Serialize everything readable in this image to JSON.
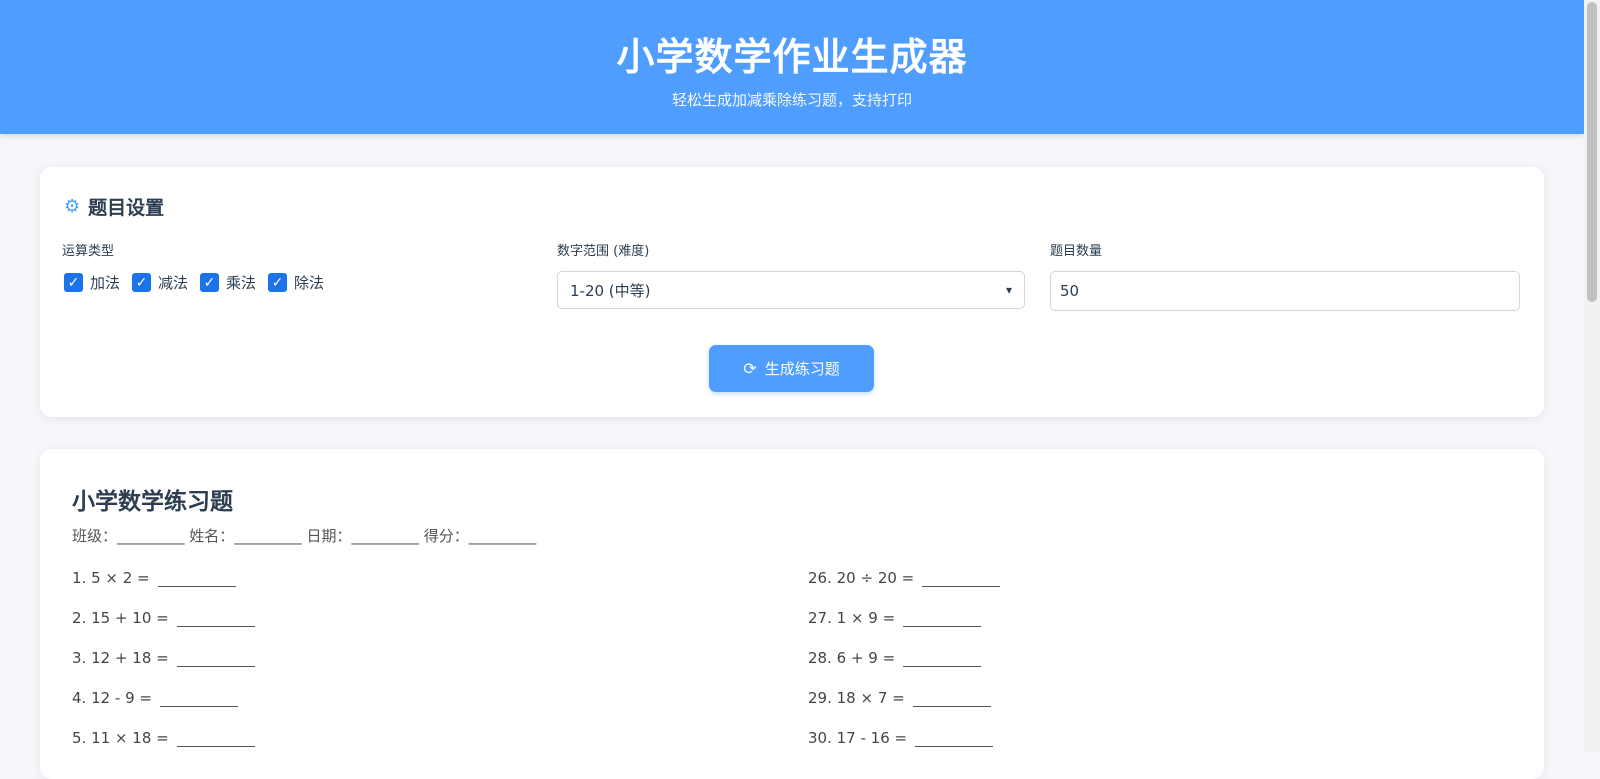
{
  "header": {
    "title": "小学数学作业生成器",
    "subtitle": "轻松生成加减乘除练习题，支持打印"
  },
  "settings": {
    "title": "题目设置",
    "operation_label": "运算类型",
    "operations": [
      "加法",
      "减法",
      "乘法",
      "除法"
    ],
    "range_label": "数字范围 (难度)",
    "range_value": "1-20 (中等)",
    "count_label": "题目数量",
    "count_value": "50",
    "generate_button": "生成练习题"
  },
  "sheet": {
    "title": "小学数学练习题",
    "meta": "班级：_________ 姓名：_________ 日期：_________ 得分：_________",
    "left_problems": [
      "1. 5 × 2 =",
      "2. 15 + 10 =",
      "3. 12 + 18 =",
      "4. 12 - 9 =",
      "5. 11 × 18 ="
    ],
    "right_problems": [
      "26. 20 ÷ 20 =",
      "27. 1 × 9 =",
      "28. 6 + 9 =",
      "29. 18 × 7 =",
      "30. 17 - 16 ="
    ]
  },
  "colors": {
    "accent": "#4f9dff",
    "checkbox": "#1a73e8"
  }
}
